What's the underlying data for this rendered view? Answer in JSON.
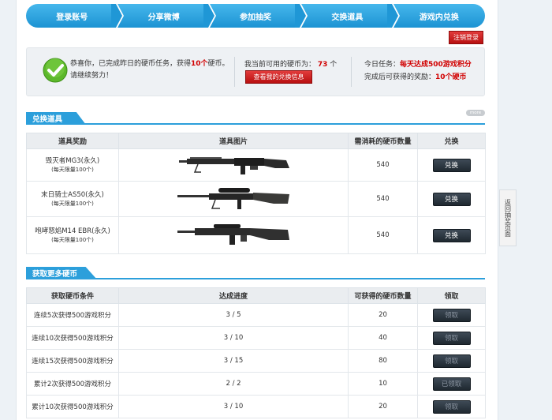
{
  "steps": [
    "登录账号",
    "分享微博",
    "参加抽奖",
    "交换道具",
    "游戏内兑换"
  ],
  "logout_label": "注销登录",
  "status": {
    "msg_part1": "恭喜你，已完成昨日的硬币任务，获得",
    "msg_coins": "10个",
    "msg_part2": "硬币。",
    "msg_line2": "请继续努力！",
    "coins_label": "我当前可用的硬币为：",
    "coins_value": "73",
    "coins_unit": "个",
    "view_button": "查看我的兑换信息",
    "today_label": "今日任务：",
    "today_task": "每天达成500游戏积分",
    "reward_label": "完成后可获得的奖励：",
    "reward_value": "10个硬币"
  },
  "exchange": {
    "title": "兑换道具",
    "more_label": "more",
    "headers": [
      "道具奖励",
      "道具图片",
      "需消耗的硬币数量",
      "兑换"
    ],
    "rows": [
      {
        "name": "毁灭者MG3(永久)",
        "limit": "(每天限量100个)",
        "cost": "540",
        "button": "兑换"
      },
      {
        "name": "末日骑士AS50(永久)",
        "limit": "(每天限量100个)",
        "cost": "540",
        "button": "兑换"
      },
      {
        "name": "咆哮怒焰M14 EBR(永久)",
        "limit": "(每天限量100个)",
        "cost": "540",
        "button": "兑换"
      }
    ]
  },
  "earn": {
    "title": "获取更多硬币",
    "headers": [
      "获取硬币条件",
      "达成进度",
      "可获得的硬币数量",
      "领取"
    ],
    "rows": [
      {
        "cond": "连续5次获得500游戏积分",
        "progress": "3 / 5",
        "coins": "20",
        "button": "领取"
      },
      {
        "cond": "连续10次获得500游戏积分",
        "progress": "3 / 10",
        "coins": "40",
        "button": "领取"
      },
      {
        "cond": "连续15次获得500游戏积分",
        "progress": "3 / 15",
        "coins": "80",
        "button": "领取"
      },
      {
        "cond": "累计2次获得500游戏积分",
        "progress": "2 / 2",
        "coins": "10",
        "button": "已领取"
      },
      {
        "cond": "累计10次获得500游戏积分",
        "progress": "3 / 10",
        "coins": "20",
        "button": "领取"
      }
    ]
  },
  "side_tab": "返回抽奖页面",
  "colors": {
    "accent": "#1c93d3",
    "highlight": "#d10000",
    "button_dark": "#2a333c"
  }
}
